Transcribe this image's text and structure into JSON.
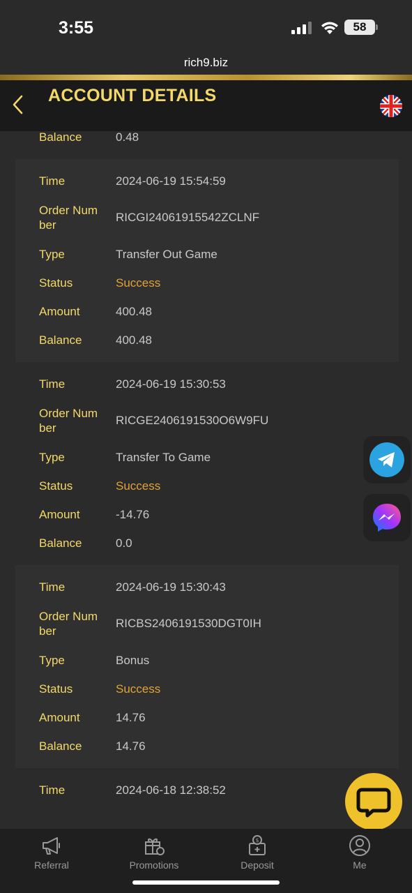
{
  "status": {
    "time": "3:55",
    "battery": "58",
    "url": "rich9.biz"
  },
  "header": {
    "title": "ACCOUNT DETAILS"
  },
  "labels": {
    "time": "Time",
    "order_line1": "Order Num",
    "order_line2": "ber",
    "type": "Type",
    "status": "Status",
    "amount": "Amount",
    "balance": "Balance"
  },
  "partial_top": {
    "balance": "0.48"
  },
  "records": [
    {
      "time": "2024-06-19 15:54:59",
      "order": "RICGI24061915542ZCLNF",
      "type": "Transfer Out Game",
      "status": "Success",
      "amount": "400.48",
      "balance": "400.48"
    },
    {
      "time": "2024-06-19 15:30:53",
      "order": "RICGE2406191530O6W9FU",
      "type": "Transfer To Game",
      "status": "Success",
      "amount": "-14.76",
      "balance": "0.0"
    },
    {
      "time": "2024-06-19 15:30:43",
      "order": "RICBS2406191530DGT0IH",
      "type": "Bonus",
      "status": "Success",
      "amount": "14.76",
      "balance": "14.76"
    }
  ],
  "partial_bottom": {
    "time": "2024-06-18 12:38:52"
  },
  "nav": [
    {
      "label": "Referral",
      "icon": "megaphone-icon"
    },
    {
      "label": "Promotions",
      "icon": "gift-icon"
    },
    {
      "label": "Deposit",
      "icon": "deposit-icon"
    },
    {
      "label": "Me",
      "icon": "user-icon"
    }
  ],
  "colors": {
    "accent": "#f3d96a",
    "success": "#e0a33a",
    "chat": "#efc12b",
    "telegram": "#2aa3e0"
  }
}
